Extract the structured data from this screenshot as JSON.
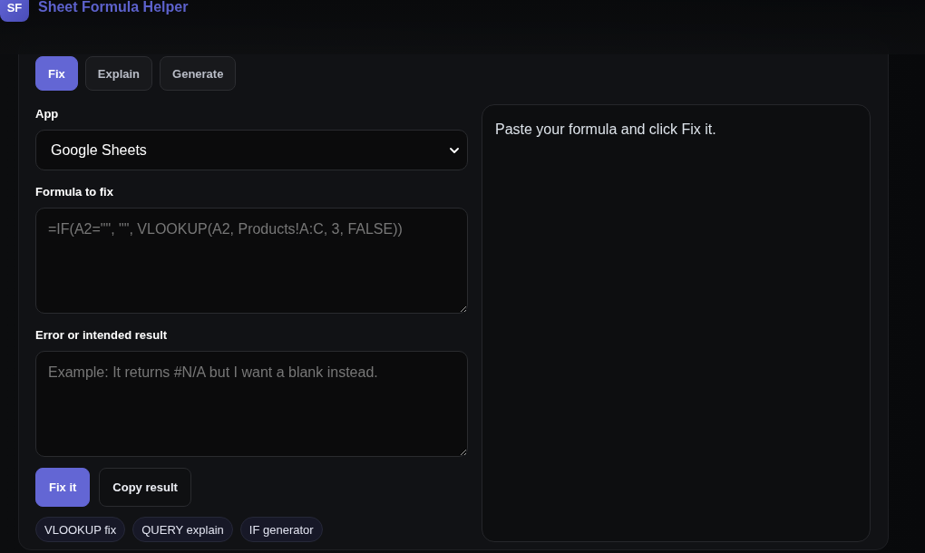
{
  "header": {
    "logo": "SF",
    "title": "Sheet Formula Helper"
  },
  "tabs": [
    {
      "label": "Fix",
      "selected": true
    },
    {
      "label": "Explain",
      "selected": false
    },
    {
      "label": "Generate",
      "selected": false
    }
  ],
  "form": {
    "app": {
      "label": "App",
      "value": "Google Sheets"
    },
    "formula": {
      "label": "Formula to fix",
      "placeholder": "=IF(A2=\"\", \"\", VLOOKUP(A2, Products!A:C, 3, FALSE))"
    },
    "intent": {
      "label": "Error or intended result",
      "placeholder": "Example: It returns #N/A but I want a blank instead."
    },
    "buttons": [
      {
        "label": "Fix it",
        "kind": "primary"
      },
      {
        "label": "Copy result",
        "kind": "secondary"
      }
    ],
    "examples": [
      "VLOOKUP fix",
      "QUERY explain",
      "IF generator"
    ]
  },
  "result": {
    "text": "Paste your formula and click Fix it."
  }
}
